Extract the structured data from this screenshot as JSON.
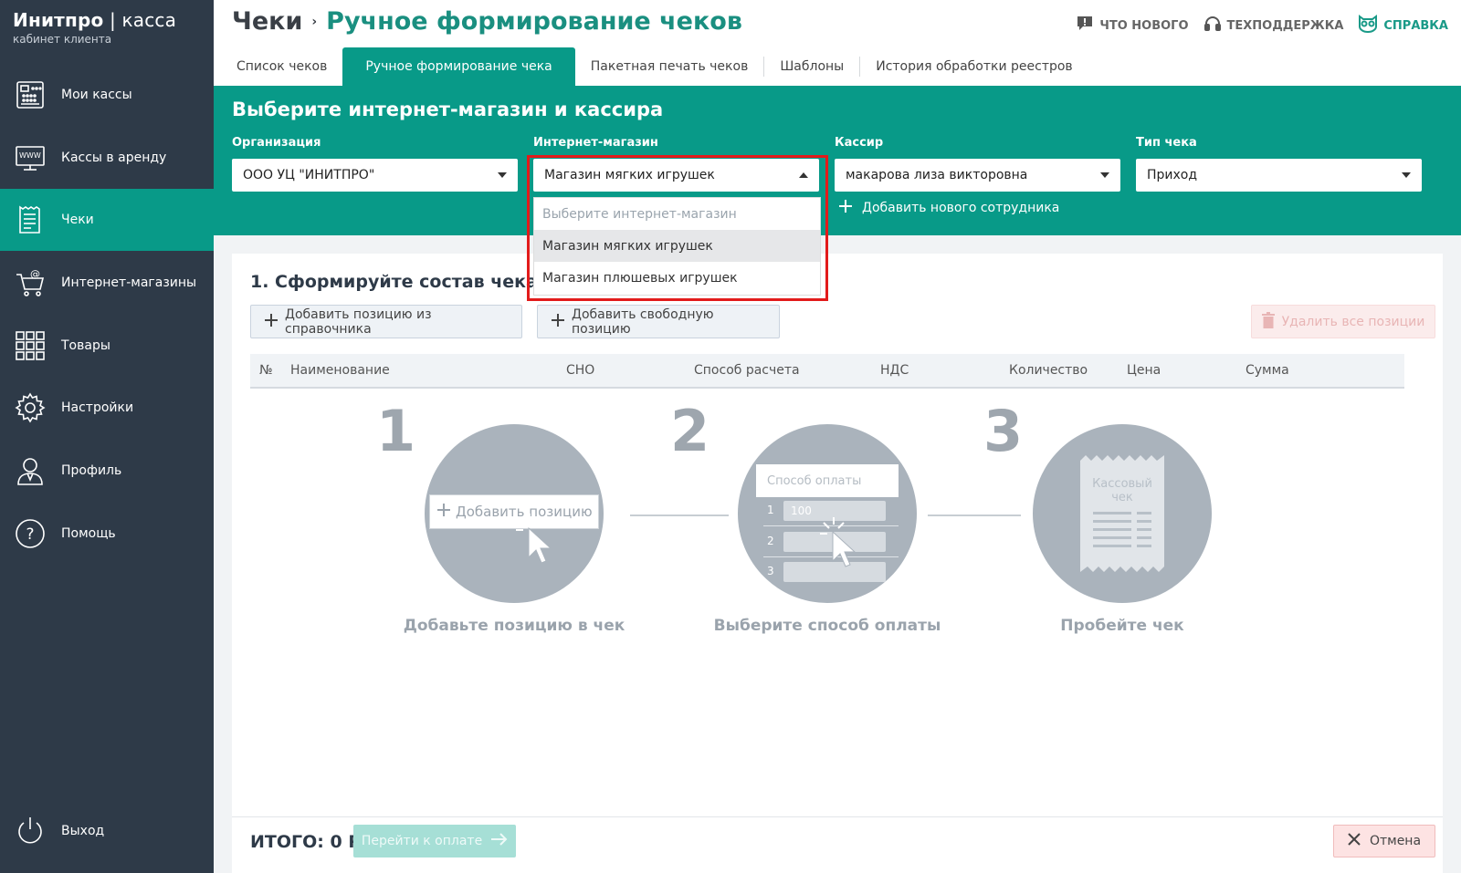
{
  "brand": {
    "title_bold": "Инитпро",
    "title_sep": " | ",
    "title_light": "касса",
    "subtitle": "кабинет клиента"
  },
  "sidebar": {
    "items": [
      {
        "label": "Мои кассы",
        "icon": "cash-register-icon"
      },
      {
        "label": "Кассы в аренду",
        "icon": "www-terminal-icon"
      },
      {
        "label": "Чеки",
        "icon": "receipt-icon",
        "active": true
      },
      {
        "label": "Интернет-магазины",
        "icon": "cart-at-icon"
      },
      {
        "label": "Товары",
        "icon": "grid-icon"
      },
      {
        "label": "Настройки",
        "icon": "gear-icon"
      },
      {
        "label": "Профиль",
        "icon": "user-icon"
      },
      {
        "label": "Помощь",
        "icon": "question-icon"
      }
    ],
    "logout": "Выход"
  },
  "header": {
    "crumb_root": "Чеки",
    "crumb_sep": "›",
    "crumb_current": "Ручное формирование чеков",
    "links": {
      "whats_new": "ЧТО НОВОГО",
      "support": "ТЕХПОДДЕРЖКА",
      "help": "СПРАВКА"
    }
  },
  "tabs": [
    "Список чеков",
    "Ручное формирование чека",
    "Пакетная печать чеков",
    "Шаблоны",
    "История обработки реестров"
  ],
  "selection": {
    "title": "Выберите интернет-магазин и кассира",
    "org_label": "Организация",
    "org_value": "ООО УЦ \"ИНИТПРО\"",
    "shop_label": "Интернет-магазин",
    "shop_value": "Магазин мягких игрушек",
    "cashier_label": "Кассир",
    "cashier_value": "макарова лиза викторовна",
    "type_label": "Тип чека",
    "type_value": "Приход",
    "add_employee": "Добавить нового сотрудника",
    "dropdown_options": [
      "Выберите интернет-магазин",
      "Магазин мягких игрушек",
      "Магазин плюшевых игрушек"
    ]
  },
  "composition": {
    "title": "1. Сформируйте состав чека",
    "add_from_catalog": "Добавить позицию из справочника",
    "add_free": "Добавить свободную позицию",
    "delete_all": "Удалить все позиции",
    "columns": [
      "№",
      "Наименование",
      "СНО",
      "Способ расчета",
      "НДС",
      "Количество",
      "Цена",
      "Сумма"
    ]
  },
  "steps": [
    {
      "num": "1",
      "caption": "Добавьте позицию в чек",
      "inner_button": "Добавить позицию"
    },
    {
      "num": "2",
      "caption": "Выберите способ оплаты",
      "inner_header": "Способ оплаты",
      "inner_rows": [
        "1",
        "2",
        "3"
      ],
      "inner_value": "100"
    },
    {
      "num": "3",
      "caption": "Пробейте чек",
      "inner_text_1": "Кассовый",
      "inner_text_2": "чек"
    }
  ],
  "footer": {
    "total": "ИТОГО: 0 Р",
    "pay": "Перейти к оплате",
    "cancel": "Отмена"
  },
  "colors": {
    "accent": "#089a88",
    "sidebar": "#2e3a48",
    "highlight": "#e21b1b"
  }
}
